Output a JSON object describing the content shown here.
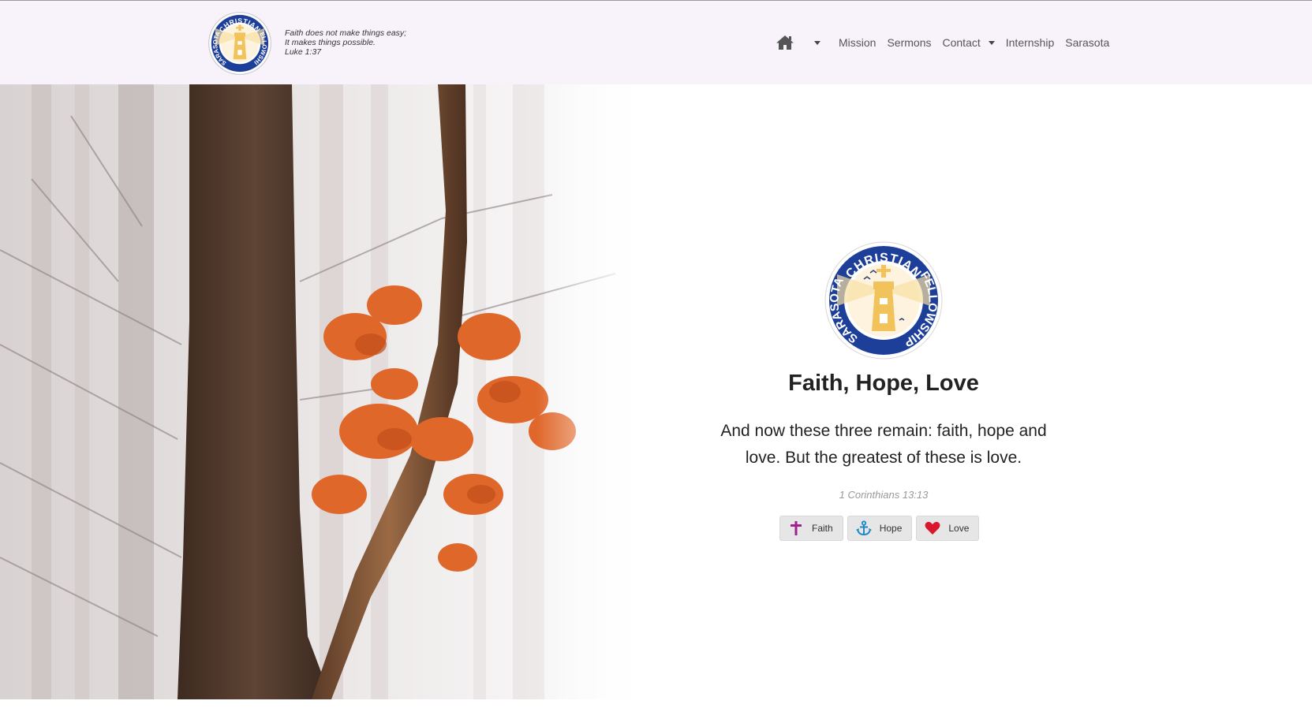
{
  "header": {
    "tagline": {
      "line1": "Faith does not make things easy;",
      "line2": "It makes things possible.",
      "line3": "Luke 1:37"
    },
    "logo": {
      "top_text": "CHRISTIAN",
      "left_text": "SARASOTA",
      "right_text": "FELLOWSHIP"
    }
  },
  "nav": {
    "home_icon": "home-icon",
    "items": [
      {
        "label": "Mission"
      },
      {
        "label": "Sermons"
      },
      {
        "label": "Contact"
      },
      {
        "label": "Internship"
      },
      {
        "label": "Sarasota"
      }
    ]
  },
  "hero": {
    "title": "Faith, Hope, Love",
    "verse": "And now these three remain: faith, hope and love. But the greatest of these is love.",
    "reference": "1 Corinthians 13:13",
    "buttons": [
      {
        "label": "Faith",
        "icon": "cross-icon",
        "color": "#a0208f"
      },
      {
        "label": "Hope",
        "icon": "anchor-icon",
        "color": "#1e88c8"
      },
      {
        "label": "Love",
        "icon": "heart-icon",
        "color": "#d9182d"
      }
    ]
  },
  "colors": {
    "header_bg": "#f8f3fb",
    "seal_blue": "#1d3f9a",
    "seal_gold": "#f2c35b"
  }
}
